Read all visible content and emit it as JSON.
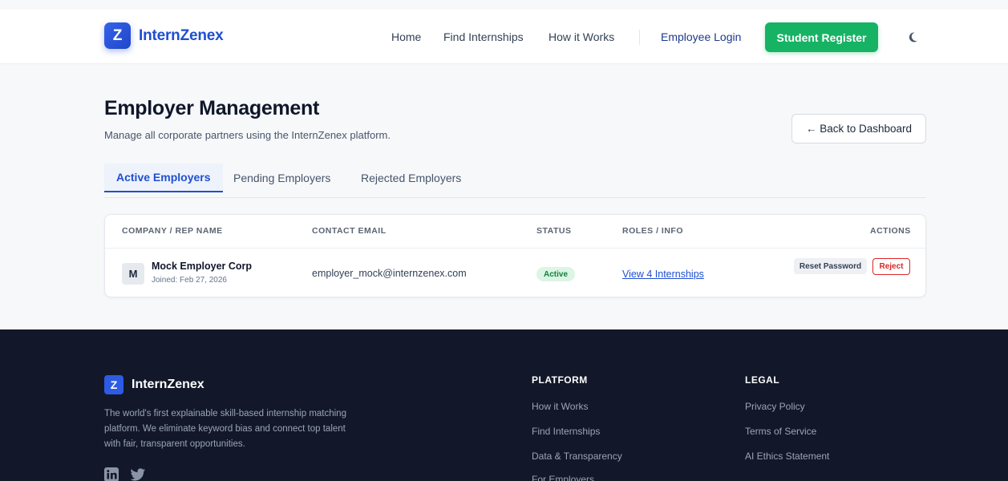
{
  "header": {
    "logo_letter": "Z",
    "brand": "InternZenex",
    "nav": {
      "home": "Home",
      "find": "Find Internships",
      "how": "How it Works",
      "employee_login": "Employee Login"
    },
    "register_label": "Student Register",
    "theme_icon": "moon-icon"
  },
  "main": {
    "title": "Employer Management",
    "subtitle": "Manage all corporate partners using the InternZenex platform.",
    "back_label": "← Back to Dashboard",
    "tabs": [
      {
        "label": "Active Employers",
        "active": true
      },
      {
        "label": "Pending Employers",
        "active": false
      },
      {
        "label": "Rejected Employers",
        "active": false
      }
    ],
    "table": {
      "columns": [
        "COMPANY / REP NAME",
        "CONTACT EMAIL",
        "STATUS",
        "ROLES / INFO",
        "ACTIONS"
      ],
      "rows": [
        {
          "avatar": "M",
          "company": "Mock Employer Corp",
          "joined": "Joined: Feb 27, 2026",
          "email": "employer_mock@internzenex.com",
          "status": "Active",
          "roles": "View 4 Internships",
          "actions": [
            "Reset Password",
            "Reject"
          ]
        }
      ]
    }
  },
  "footer": {
    "logo_letter": "Z",
    "brand": "InternZenex",
    "description": "The world's first explainable skill-based internship matching platform. We eliminate keyword bias and connect top talent with fair, transparent opportunities.",
    "social": [
      "linkedin-icon",
      "twitter-icon"
    ],
    "platform": {
      "title": "PLATFORM",
      "links": [
        "How it Works",
        "Find Internships",
        "Data & Transparency",
        "For Employers"
      ]
    },
    "legal": {
      "title": "LEGAL",
      "links": [
        "Privacy Policy",
        "Terms of Service",
        "AI Ethics Statement"
      ]
    }
  },
  "colors": {
    "brand_blue": "#1f4fd1",
    "register_green": "#16b364",
    "footer_bg": "#121829",
    "reject_red": "#dc2626"
  }
}
